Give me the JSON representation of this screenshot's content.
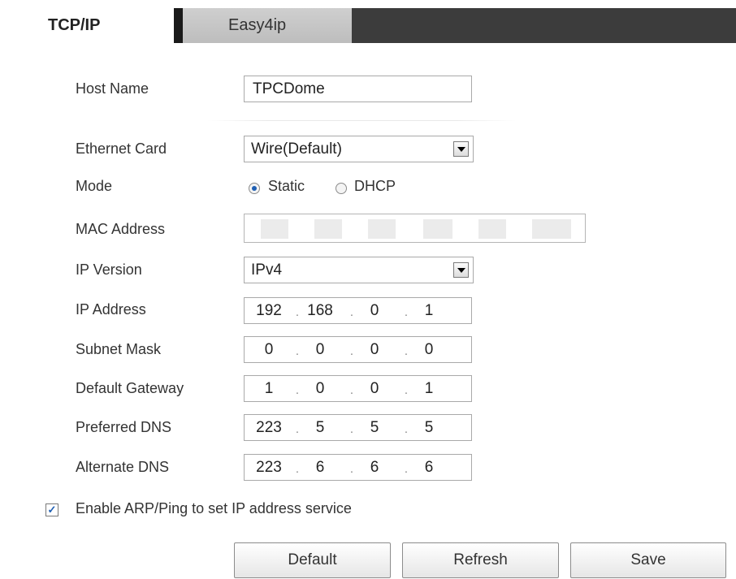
{
  "tabs": [
    {
      "label": "TCP/IP",
      "active": true
    },
    {
      "label": "Easy4ip",
      "active": false
    }
  ],
  "form": {
    "host_name": {
      "label": "Host Name",
      "value": "TPCDome"
    },
    "ethernet_card": {
      "label": "Ethernet Card",
      "value": "Wire(Default)"
    },
    "mode": {
      "label": "Mode",
      "options": [
        "Static",
        "DHCP"
      ],
      "selected": "Static"
    },
    "mac_address": {
      "label": "MAC Address",
      "value": ""
    },
    "ip_version": {
      "label": "IP Version",
      "value": "IPv4"
    },
    "ip_address": {
      "label": "IP Address",
      "octets": [
        "192",
        "168",
        "0",
        "1"
      ]
    },
    "subnet_mask": {
      "label": "Subnet Mask",
      "octets": [
        "0",
        "0",
        "0",
        "0"
      ]
    },
    "default_gateway": {
      "label": "Default Gateway",
      "octets": [
        "1",
        "0",
        "0",
        "1"
      ]
    },
    "preferred_dns": {
      "label": "Preferred DNS",
      "octets": [
        "223",
        "5",
        "5",
        "5"
      ]
    },
    "alternate_dns": {
      "label": "Alternate DNS",
      "octets": [
        "223",
        "6",
        "6",
        "6"
      ]
    },
    "arp_ping": {
      "label": "Enable ARP/Ping to set IP address service",
      "checked": true
    }
  },
  "buttons": {
    "default": "Default",
    "refresh": "Refresh",
    "save": "Save"
  },
  "colors": {
    "tab_bar": "#3c3c3c",
    "radio_selected": "#1f5fb3"
  }
}
